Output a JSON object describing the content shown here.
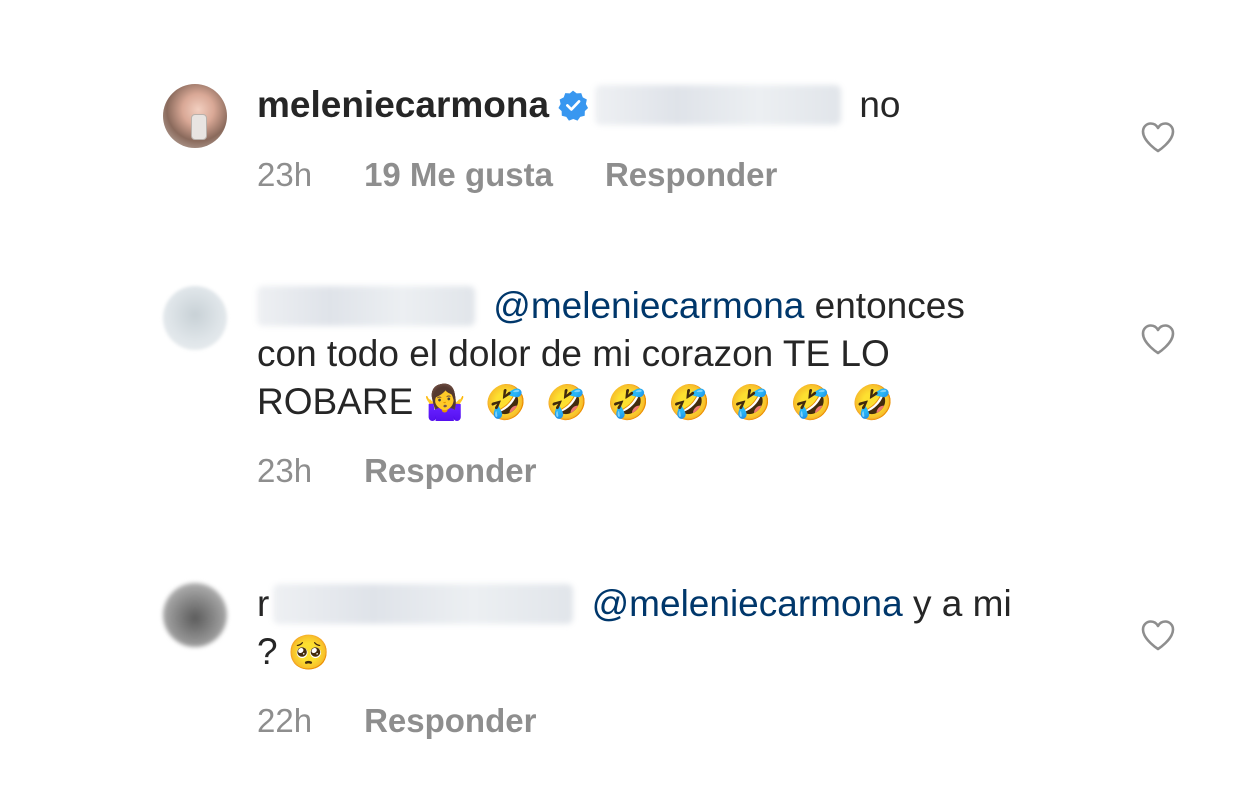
{
  "comments": [
    {
      "username": "meleniecarmona",
      "verified": true,
      "mention_blurred": true,
      "text": "no",
      "time": "23h",
      "likes": "19 Me gusta",
      "reply": "Responder"
    },
    {
      "username_blurred": true,
      "mention": "@meleniecarmona",
      "text_line1": "entonces",
      "text_line2": "con todo el dolor de mi corazon TE LO",
      "text_line3": "ROBARE",
      "emojis": "🤷‍♀️ 🤣 🤣 🤣 🤣 🤣 🤣 🤣",
      "time": "23h",
      "reply": "Responder"
    },
    {
      "username_prefix": "r",
      "username_blurred": true,
      "mention": "@meleniecarmona",
      "text_line1": "y a mi",
      "text_line2": "?",
      "emojis": "🥺",
      "time": "22h",
      "reply": "Responder"
    }
  ],
  "icons": {
    "like": "heart-outline-icon",
    "verified": "verified-badge-icon"
  },
  "colors": {
    "mention": "#00376b",
    "meta": "#8e8e8e",
    "verified": "#3897f0"
  }
}
